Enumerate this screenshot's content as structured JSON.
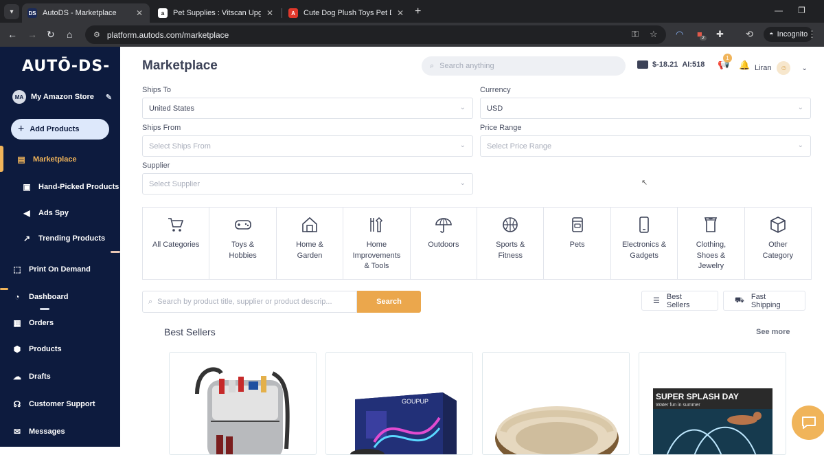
{
  "browser": {
    "tabs": [
      {
        "title": "AutoDS - Marketplace",
        "favicon": "DS"
      },
      {
        "title": "Pet Supplies : Vitscan Upgraded",
        "favicon": "a"
      },
      {
        "title": "Cute Dog Plush Toys Pet Duck S",
        "favicon": "A"
      }
    ],
    "url": "platform.autods.com/marketplace",
    "incognito_label": "Incognito",
    "extension_badge": "2"
  },
  "sidebar": {
    "logo": "AUTŌ-DS-",
    "store_initials": "MA",
    "store_name": "My Amazon Store",
    "add_products": "Add Products",
    "items": [
      {
        "label": "Marketplace",
        "icon": "marketplace-icon"
      },
      {
        "label": "Hand-Picked Products",
        "icon": "hand-picked-icon"
      },
      {
        "label": "Ads Spy",
        "icon": "megaphone-icon"
      },
      {
        "label": "Trending Products",
        "icon": "trend-chart-icon"
      },
      {
        "label": "Print On Demand",
        "icon": "print-on-demand-icon"
      },
      {
        "label": "Dashboard",
        "icon": "dashboard-icon"
      },
      {
        "label": "Orders",
        "icon": "orders-icon"
      },
      {
        "label": "Products",
        "icon": "products-box-icon"
      },
      {
        "label": "Drafts",
        "icon": "drafts-cloud-icon"
      },
      {
        "label": "Customer Support",
        "icon": "support-icon"
      },
      {
        "label": "Messages",
        "icon": "mail-icon"
      }
    ],
    "accent": "#f0b45a",
    "background": "#0d1b3e"
  },
  "header": {
    "title": "Marketplace",
    "search_placeholder": "Search anything",
    "balance": "$-18.21",
    "ai_credits": "AI:518",
    "notifications": "1",
    "user_name": "Liran"
  },
  "filters": {
    "ships_to": {
      "label": "Ships To",
      "value": "United States"
    },
    "currency": {
      "label": "Currency",
      "value": "USD"
    },
    "ships_from": {
      "label": "Ships From",
      "placeholder": "Select Ships From"
    },
    "price_range": {
      "label": "Price Range",
      "placeholder": "Select Price Range"
    },
    "supplier": {
      "label": "Supplier",
      "placeholder": "Select Supplier"
    }
  },
  "categories": [
    {
      "label": "All Categories",
      "icon": "cart-icon"
    },
    {
      "label": "Toys &\nHobbies",
      "icon": "gamepad-icon"
    },
    {
      "label": "Home &\nGarden",
      "icon": "house-icon"
    },
    {
      "label": "Home\nImprovements\n& Tools",
      "icon": "tools-icon"
    },
    {
      "label": "Outdoors",
      "icon": "umbrella-icon"
    },
    {
      "label": "Sports &\nFitness",
      "icon": "basketball-icon"
    },
    {
      "label": "Pets",
      "icon": "pet-food-icon"
    },
    {
      "label": "Electronics &\nGadgets",
      "icon": "phone-icon"
    },
    {
      "label": "Clothing,\nShoes &\nJewelry",
      "icon": "shirt-icon"
    },
    {
      "label": "Other\nCategory",
      "icon": "cube-icon"
    }
  ],
  "product_search": {
    "placeholder": "Search by product title, supplier or product descrip...",
    "button": "Search"
  },
  "chips": {
    "best_sellers": "Best Sellers",
    "fast_shipping": "Fast Shipping"
  },
  "best_sellers": {
    "title": "Best Sellers",
    "see_more": "See more",
    "product_4_banner": "SUPER SPLASH DAY",
    "product_4_subtitle": "Water fun in summer",
    "product_2_brand": "GOUPUP"
  }
}
